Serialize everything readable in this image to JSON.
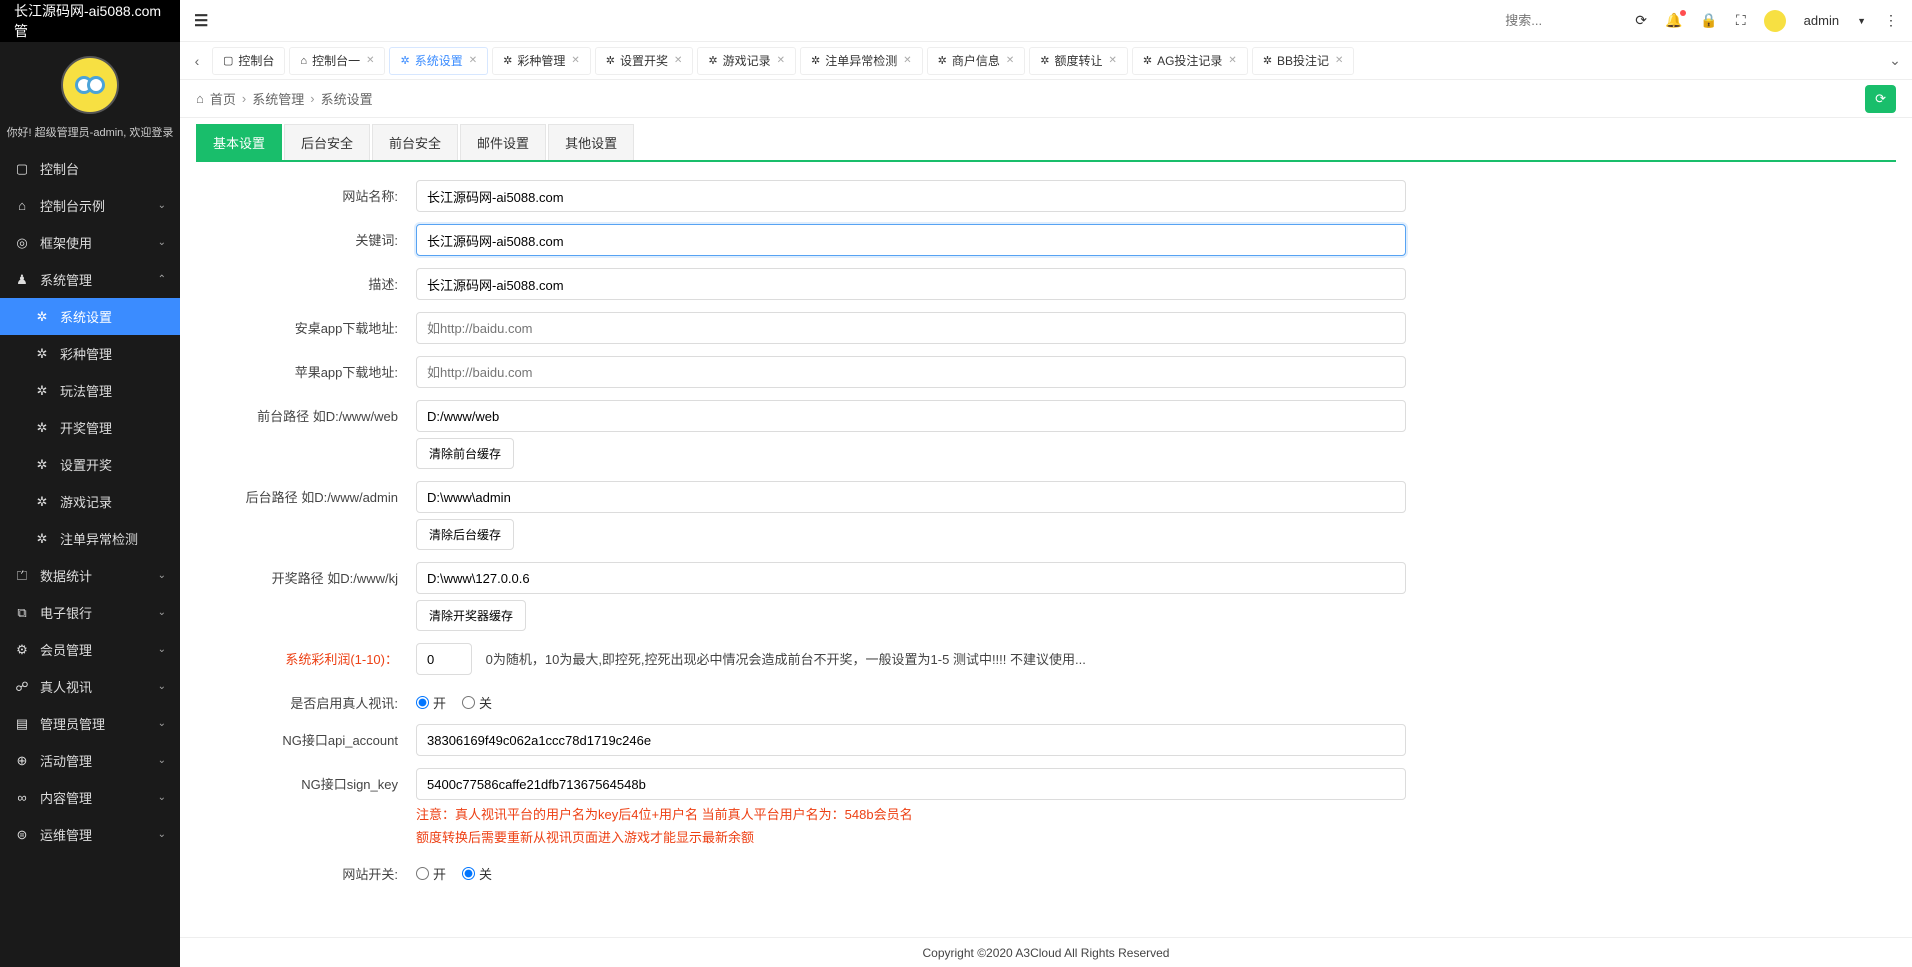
{
  "brand": "长江源码网-ai5088.com管",
  "welcome": "你好! 超级管理员-admin, 欢迎登录",
  "sidebar": {
    "items": [
      {
        "icon": "▢",
        "label": "控制台",
        "arrow": ""
      },
      {
        "icon": "⌂",
        "label": "控制台示例",
        "arrow": "⌄"
      },
      {
        "icon": "◎",
        "label": "框架使用",
        "arrow": "⌄"
      },
      {
        "icon": "♟",
        "label": "系统管理",
        "arrow": "⌃",
        "expanded": true
      },
      {
        "icon": "✲",
        "label": "系统设置",
        "sub": true,
        "active": true
      },
      {
        "icon": "✲",
        "label": "彩种管理",
        "sub": true
      },
      {
        "icon": "✲",
        "label": "玩法管理",
        "sub": true
      },
      {
        "icon": "✲",
        "label": "开奖管理",
        "sub": true
      },
      {
        "icon": "✲",
        "label": "设置开奖",
        "sub": true
      },
      {
        "icon": "✲",
        "label": "游戏记录",
        "sub": true
      },
      {
        "icon": "✲",
        "label": "注单异常检测",
        "sub": true
      },
      {
        "icon": "⏍",
        "label": "数据统计",
        "arrow": "⌄"
      },
      {
        "icon": "⧉",
        "label": "电子银行",
        "arrow": "⌄"
      },
      {
        "icon": "⚙",
        "label": "会员管理",
        "arrow": "⌄"
      },
      {
        "icon": "☍",
        "label": "真人视讯",
        "arrow": "⌄"
      },
      {
        "icon": "▤",
        "label": "管理员管理",
        "arrow": "⌄"
      },
      {
        "icon": "⊕",
        "label": "活动管理",
        "arrow": "⌄"
      },
      {
        "icon": "∞",
        "label": "内容管理",
        "arrow": "⌄"
      },
      {
        "icon": "⊜",
        "label": "运维管理",
        "arrow": "⌄"
      }
    ]
  },
  "topbar": {
    "search_placeholder": "搜索...",
    "admin": "admin"
  },
  "tabs": [
    {
      "icon": "▢",
      "label": "控制台",
      "closable": false
    },
    {
      "icon": "⌂",
      "label": "控制台一",
      "closable": true
    },
    {
      "icon": "✲",
      "label": "系统设置",
      "closable": true,
      "active": true
    },
    {
      "icon": "✲",
      "label": "彩种管理",
      "closable": true
    },
    {
      "icon": "✲",
      "label": "设置开奖",
      "closable": true
    },
    {
      "icon": "✲",
      "label": "游戏记录",
      "closable": true
    },
    {
      "icon": "✲",
      "label": "注单异常检测",
      "closable": true
    },
    {
      "icon": "✲",
      "label": "商户信息",
      "closable": true
    },
    {
      "icon": "✲",
      "label": "额度转让",
      "closable": true
    },
    {
      "icon": "✲",
      "label": "AG投注记录",
      "closable": true
    },
    {
      "icon": "✲",
      "label": "BB投注记",
      "closable": true
    }
  ],
  "breadcrumb": {
    "home": "首页",
    "l1": "系统管理",
    "l2": "系统设置"
  },
  "subtabs": [
    "基本设置",
    "后台安全",
    "前台安全",
    "邮件设置",
    "其他设置"
  ],
  "form": {
    "site_name": {
      "label": "网站名称:",
      "value": "长江源码网-ai5088.com"
    },
    "keywords": {
      "label": "关键词:",
      "value": "长江源码网-ai5088.com"
    },
    "desc": {
      "label": "描述:",
      "value": "长江源码网-ai5088.com"
    },
    "android": {
      "label": "安桌app下载地址:",
      "placeholder": "如http://baidu.com",
      "value": ""
    },
    "ios": {
      "label": "苹果app下载地址:",
      "placeholder": "如http://baidu.com",
      "value": ""
    },
    "front_path": {
      "label": "前台路径 如D:/www/web",
      "value": "D:/www/web",
      "btn": "清除前台缓存"
    },
    "admin_path": {
      "label": "后台路径 如D:/www/admin",
      "value": "D:\\www\\admin",
      "btn": "清除后台缓存"
    },
    "kj_path": {
      "label": "开奖路径 如D:/www/kj",
      "value": "D:\\www\\127.0.0.6",
      "btn": "清除开奖器缓存"
    },
    "profit": {
      "label": "系统彩利润(1-10)：",
      "value": "0",
      "hint": "0为随机，10为最大,即控死,控死出现必中情况会造成前台不开奖，一般设置为1-5 测试中!!!! 不建议使用..."
    },
    "real_video": {
      "label": "是否启用真人视讯:",
      "on": "开",
      "off": "关",
      "value": "on"
    },
    "ng_account": {
      "label": "NG接口api_account",
      "value": "38306169f49c062a1ccc78d1719c246e"
    },
    "ng_sign": {
      "label": "NG接口sign_key",
      "value": "5400c77586caffe21dfb71367564548b"
    },
    "note1": "注意：真人视讯平台的用户名为key后4位+用户名 当前真人平台用户名为：548b会员名",
    "note2": "额度转换后需要重新从视讯页面进入游戏才能显示最新余额",
    "site_switch": {
      "label": "网站开关:",
      "on": "开",
      "off": "关",
      "value": "off"
    }
  },
  "footer": "Copyright ©2020 A3Cloud All Rights Reserved"
}
